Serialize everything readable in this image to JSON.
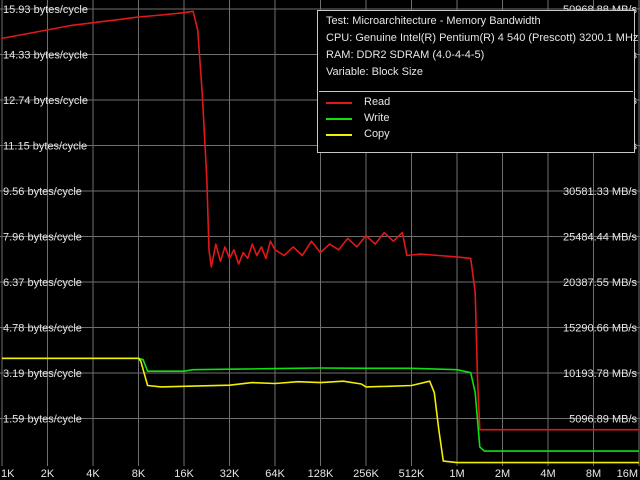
{
  "chart_data": {
    "type": "line",
    "y_left_ticks": [
      "15.93 bytes/cycle",
      "14.33 bytes/cycle",
      "12.74 bytes/cycle",
      "11.15 bytes/cycle",
      "9.56 bytes/cycle",
      "7.96 bytes/cycle",
      "6.37 bytes/cycle",
      "4.78 bytes/cycle",
      "3.19 bytes/cycle",
      "1.59 bytes/cycle"
    ],
    "y_right_ticks": [
      "50968.88 MB/s",
      "45871.99 MB/s",
      "40775.10 MB/s",
      "35678.22 MB/s",
      "30581.33 MB/s",
      "25484.44 MB/s",
      "20387.55 MB/s",
      "15290.66 MB/s",
      "10193.78 MB/s",
      "5096.89 MB/s"
    ],
    "x_ticks": [
      "1K",
      "2K",
      "4K",
      "8K",
      "16K",
      "32K",
      "64K",
      "128K",
      "256K",
      "512K",
      "1M",
      "2M",
      "4M",
      "8M",
      "16M"
    ],
    "ylim": [
      0,
      15.93
    ],
    "x_log2_kb_range": [
      0,
      14
    ],
    "grid": true,
    "grid_color": "#707070",
    "info": {
      "test": "Test: Microarchitecture - Memory Bandwidth",
      "cpu": "CPU: Genuine Intel(R) Pentium(R) 4 540 (Prescott) 3200.1 MHz",
      "ram": "RAM: DDR2 SDRAM (4.0-4-4-5)",
      "variable": "Variable: Block Size"
    },
    "legend_position": "top-right",
    "series": [
      {
        "name": "Read",
        "color": "#e01818",
        "points": [
          [
            0,
            14.9
          ],
          [
            0.5,
            15.05
          ],
          [
            1,
            15.2
          ],
          [
            1.5,
            15.35
          ],
          [
            2,
            15.45
          ],
          [
            2.5,
            15.55
          ],
          [
            3,
            15.65
          ],
          [
            3.5,
            15.72
          ],
          [
            4,
            15.8
          ],
          [
            4.2,
            15.85
          ],
          [
            4.3,
            15.2
          ],
          [
            4.4,
            13.0
          ],
          [
            4.5,
            10.0
          ],
          [
            4.55,
            7.5
          ],
          [
            4.6,
            6.9
          ],
          [
            4.7,
            7.7
          ],
          [
            4.8,
            7.1
          ],
          [
            4.9,
            7.6
          ],
          [
            5,
            7.2
          ],
          [
            5.1,
            7.5
          ],
          [
            5.2,
            7.0
          ],
          [
            5.3,
            7.4
          ],
          [
            5.4,
            7.2
          ],
          [
            5.5,
            7.7
          ],
          [
            5.6,
            7.3
          ],
          [
            5.7,
            7.6
          ],
          [
            5.8,
            7.2
          ],
          [
            5.9,
            7.8
          ],
          [
            6,
            7.5
          ],
          [
            6.2,
            7.3
          ],
          [
            6.4,
            7.6
          ],
          [
            6.6,
            7.3
          ],
          [
            6.8,
            7.8
          ],
          [
            7,
            7.4
          ],
          [
            7.2,
            7.7
          ],
          [
            7.4,
            7.5
          ],
          [
            7.6,
            7.9
          ],
          [
            7.8,
            7.6
          ],
          [
            8,
            8.0
          ],
          [
            8.2,
            7.7
          ],
          [
            8.4,
            8.1
          ],
          [
            8.6,
            7.8
          ],
          [
            8.8,
            8.1
          ],
          [
            8.9,
            7.3
          ],
          [
            9.2,
            7.35
          ],
          [
            9.6,
            7.3
          ],
          [
            10,
            7.25
          ],
          [
            10.3,
            7.2
          ],
          [
            10.4,
            6.0
          ],
          [
            10.45,
            3.0
          ],
          [
            10.5,
            1.2
          ],
          [
            10.6,
            1.2
          ],
          [
            12,
            1.2
          ],
          [
            14,
            1.2
          ]
        ]
      },
      {
        "name": "Write",
        "color": "#10e010",
        "points": [
          [
            0,
            3.7
          ],
          [
            2,
            3.7
          ],
          [
            3,
            3.7
          ],
          [
            3.1,
            3.65
          ],
          [
            3.2,
            3.25
          ],
          [
            4,
            3.25
          ],
          [
            4.2,
            3.3
          ],
          [
            5,
            3.32
          ],
          [
            6,
            3.34
          ],
          [
            7,
            3.36
          ],
          [
            8,
            3.35
          ],
          [
            9,
            3.35
          ],
          [
            10,
            3.3
          ],
          [
            10.3,
            3.2
          ],
          [
            10.4,
            2.5
          ],
          [
            10.5,
            0.6
          ],
          [
            10.6,
            0.45
          ],
          [
            11,
            0.45
          ],
          [
            12,
            0.45
          ],
          [
            14,
            0.45
          ]
        ]
      },
      {
        "name": "Copy",
        "color": "#f0f000",
        "points": [
          [
            0,
            3.7
          ],
          [
            3,
            3.7
          ],
          [
            3.05,
            3.6
          ],
          [
            3.2,
            2.75
          ],
          [
            3.5,
            2.7
          ],
          [
            4,
            2.72
          ],
          [
            5,
            2.76
          ],
          [
            5.5,
            2.85
          ],
          [
            6,
            2.82
          ],
          [
            6.5,
            2.88
          ],
          [
            7,
            2.85
          ],
          [
            7.5,
            2.9
          ],
          [
            7.9,
            2.8
          ],
          [
            8,
            2.7
          ],
          [
            8.5,
            2.72
          ],
          [
            9,
            2.75
          ],
          [
            9.4,
            2.9
          ],
          [
            9.5,
            2.5
          ],
          [
            9.6,
            1.2
          ],
          [
            9.7,
            0.1
          ],
          [
            10,
            0.05
          ],
          [
            14,
            0.05
          ]
        ]
      }
    ]
  }
}
